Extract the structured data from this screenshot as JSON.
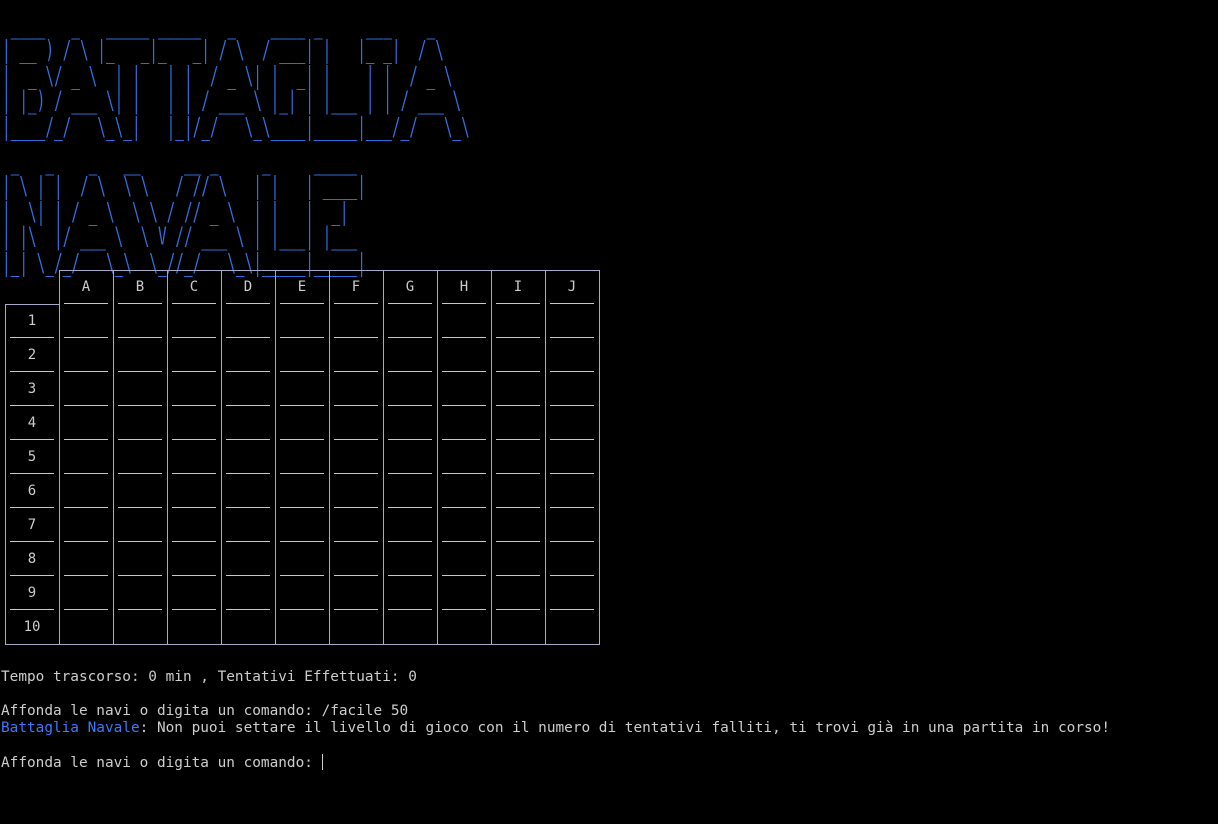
{
  "banner": {
    "line1": " ____   _   _____ _____   _    ____ _     ___    _   \n| __ ) / \\ |_   _|_   _| / \\  / ___| |   |_ _|  / \\  \n|  _ \\/ _ \\  | |   | |  / _ \\| |  _| |    | |  / _ \\ \n| |_) / ___ \\| |   | | / ___ \\ |_| | |___ | | / ___ \\\n|____/_/   \\_\\_|   |_|/_/   \\_\\____|_____|___/_/   \\_\\",
    "line2": " _   _    _   __     __ _     _     _____ \n| \\ | |  / \\  \\ \\   / // \\   | |   | ____|\n|  \\| | / _ \\  \\ \\ / // _ \\  | |   |  _|  \n| |\\  |/ ___ \\  \\ V // ___ \\ | |___| |___ \n|_| \\_/_/   \\_\\  \\_//_/   \\_\\|_____|_____|"
  },
  "grid": {
    "columns": [
      "A",
      "B",
      "C",
      "D",
      "E",
      "F",
      "G",
      "H",
      "I",
      "J"
    ],
    "rows": [
      "1",
      "2",
      "3",
      "4",
      "5",
      "6",
      "7",
      "8",
      "9",
      "10"
    ]
  },
  "status": {
    "text": "Tempo trascorso: 0 min , Tentativi Effettuati: 0"
  },
  "console": {
    "prompt1": "Affonda le navi o digita un comando: /facile 50",
    "sender": "Battaglia Navale",
    "message": ": Non puoi settare il livello di gioco con il numero di tentativi falliti, ti trovi già in una partita in corso!",
    "prompt2": "Affonda le navi o digita un comando: "
  },
  "colors": {
    "background": "#000000",
    "text": "#cccccc",
    "accent": "#3b78ff",
    "grid_border": "#a8a8c8"
  }
}
